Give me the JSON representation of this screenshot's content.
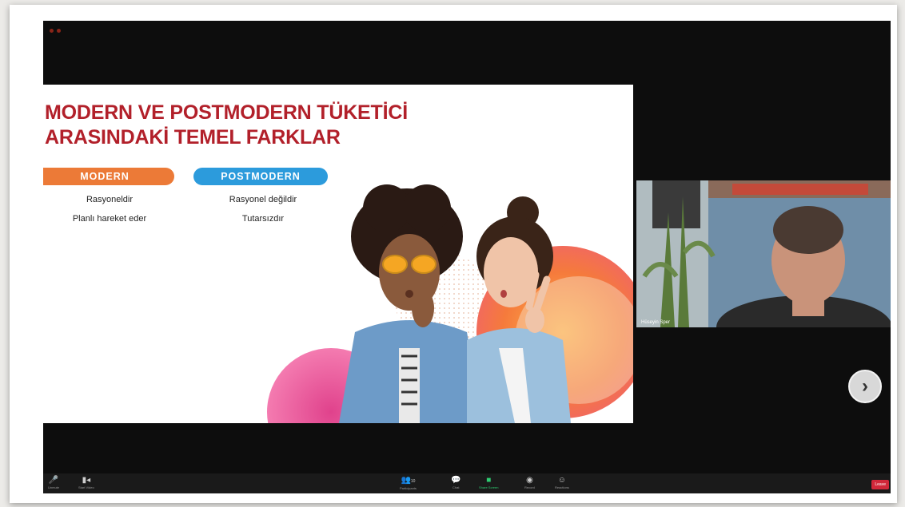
{
  "slide": {
    "title_line1": "MODERN VE POSTMODERN TÜKETİCİ",
    "title_line2": "ARASINDAKİ TEMEL FARKLAR",
    "modern": {
      "label": "MODERN",
      "items": [
        "Rasyoneldir",
        "Planlı hareket eder"
      ]
    },
    "postmodern": {
      "label": "POSTMODERN",
      "items": [
        "Rasyonel değildir",
        "Tutarsızdır"
      ]
    }
  },
  "video": {
    "participant_name": "Hüseyin Sper"
  },
  "toolbar": {
    "mute_label": "Unmute",
    "video_label": "Start Video",
    "participants_label": "Participants",
    "participants_count": "10",
    "chat_label": "Chat",
    "share_label": "Share Screen",
    "record_label": "Record",
    "reactions_label": "Reactions",
    "leave_label": "Leave"
  },
  "icons": {
    "mic": "microphone-icon",
    "video": "video-camera-icon",
    "participants": "participants-icon",
    "chat": "chat-icon",
    "share": "share-screen-icon",
    "record": "record-icon",
    "reactions": "reactions-icon",
    "next": "chevron-right-icon"
  },
  "colors": {
    "title_red": "#b2202a",
    "modern_orange": "#ec7a37",
    "postmodern_blue": "#2c9bdc",
    "share_green": "#2ecc71",
    "leave_red": "#d1283a"
  }
}
